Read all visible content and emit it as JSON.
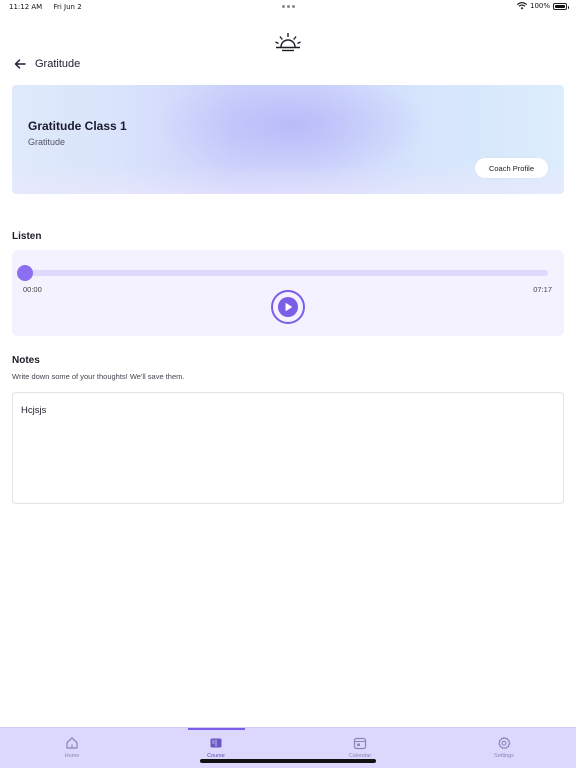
{
  "status_bar": {
    "time": "11:12 AM",
    "date": "Fri Jun 2",
    "battery": "100%"
  },
  "header": {
    "title": "Gratitude",
    "logo_icon": "sunrise-icon"
  },
  "course_card": {
    "title": "Gratitude Class 1",
    "category": "Gratitude",
    "coach_button": "Coach Profile"
  },
  "listen": {
    "heading": "Listen",
    "current_time": "00:00",
    "duration": "07:17",
    "progress": 0
  },
  "notes": {
    "heading": "Notes",
    "hint": "Write down some of your thoughts! We'll save them.",
    "value": "Hcjsjs"
  },
  "tabs": [
    {
      "label": "Home",
      "icon": "home-icon",
      "active": false
    },
    {
      "label": "Course",
      "icon": "book-icon",
      "active": true
    },
    {
      "label": "Calendar",
      "icon": "calendar-icon",
      "active": false
    },
    {
      "label": "Settings",
      "icon": "gear-icon",
      "active": false
    }
  ],
  "colors": {
    "accent": "#7b5de8",
    "tabbar": "#dcd7fc",
    "player_bg": "#f4f2fe"
  }
}
